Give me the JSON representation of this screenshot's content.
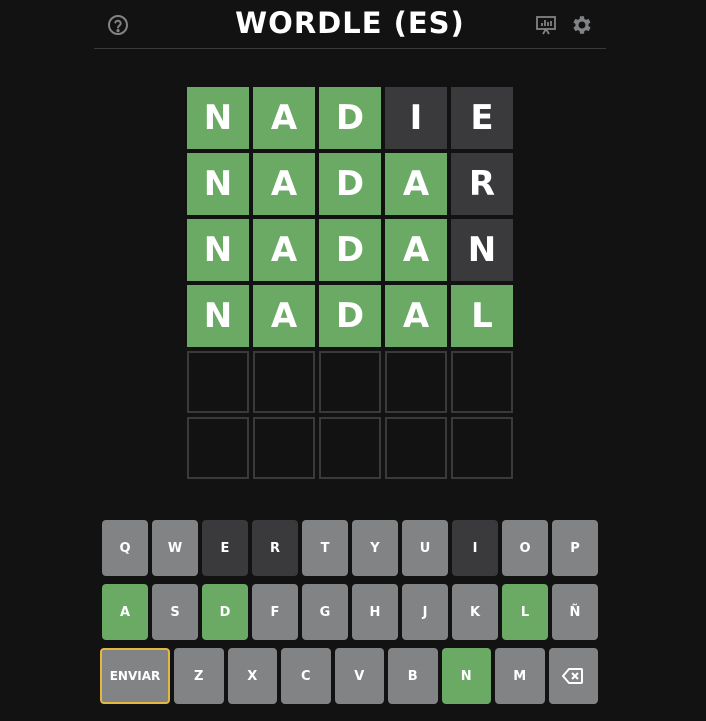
{
  "header": {
    "title": "WORDLE (ES)",
    "icons": [
      "help-icon",
      "stats-icon",
      "settings-icon"
    ]
  },
  "colors": {
    "correct": "#6aaa64",
    "absent": "#3a3a3c",
    "unused": "#818384",
    "background": "#121213",
    "enter_border": "#e4b73f"
  },
  "board": {
    "rows": [
      [
        {
          "l": "N",
          "s": "correct"
        },
        {
          "l": "A",
          "s": "correct"
        },
        {
          "l": "D",
          "s": "correct"
        },
        {
          "l": "I",
          "s": "absent"
        },
        {
          "l": "E",
          "s": "absent"
        }
      ],
      [
        {
          "l": "N",
          "s": "correct"
        },
        {
          "l": "A",
          "s": "correct"
        },
        {
          "l": "D",
          "s": "correct"
        },
        {
          "l": "A",
          "s": "correct"
        },
        {
          "l": "R",
          "s": "absent"
        }
      ],
      [
        {
          "l": "N",
          "s": "correct"
        },
        {
          "l": "A",
          "s": "correct"
        },
        {
          "l": "D",
          "s": "correct"
        },
        {
          "l": "A",
          "s": "correct"
        },
        {
          "l": "N",
          "s": "absent"
        }
      ],
      [
        {
          "l": "N",
          "s": "correct"
        },
        {
          "l": "A",
          "s": "correct"
        },
        {
          "l": "D",
          "s": "correct"
        },
        {
          "l": "A",
          "s": "correct"
        },
        {
          "l": "L",
          "s": "correct"
        }
      ],
      [
        {
          "l": "",
          "s": "empty"
        },
        {
          "l": "",
          "s": "empty"
        },
        {
          "l": "",
          "s": "empty"
        },
        {
          "l": "",
          "s": "empty"
        },
        {
          "l": "",
          "s": "empty"
        }
      ],
      [
        {
          "l": "",
          "s": "empty"
        },
        {
          "l": "",
          "s": "empty"
        },
        {
          "l": "",
          "s": "empty"
        },
        {
          "l": "",
          "s": "empty"
        },
        {
          "l": "",
          "s": "empty"
        }
      ]
    ]
  },
  "keyboard": {
    "rows": [
      [
        {
          "k": "Q",
          "s": "unused"
        },
        {
          "k": "W",
          "s": "unused"
        },
        {
          "k": "E",
          "s": "absent"
        },
        {
          "k": "R",
          "s": "absent"
        },
        {
          "k": "T",
          "s": "unused"
        },
        {
          "k": "Y",
          "s": "unused"
        },
        {
          "k": "U",
          "s": "unused"
        },
        {
          "k": "I",
          "s": "absent"
        },
        {
          "k": "O",
          "s": "unused"
        },
        {
          "k": "P",
          "s": "unused"
        }
      ],
      [
        {
          "k": "A",
          "s": "correct"
        },
        {
          "k": "S",
          "s": "unused"
        },
        {
          "k": "D",
          "s": "correct"
        },
        {
          "k": "F",
          "s": "unused"
        },
        {
          "k": "G",
          "s": "unused"
        },
        {
          "k": "H",
          "s": "unused"
        },
        {
          "k": "J",
          "s": "unused"
        },
        {
          "k": "K",
          "s": "unused"
        },
        {
          "k": "L",
          "s": "correct"
        },
        {
          "k": "Ñ",
          "s": "unused"
        }
      ],
      [
        {
          "k": "ENVIAR",
          "s": "enter"
        },
        {
          "k": "Z",
          "s": "unused"
        },
        {
          "k": "X",
          "s": "unused"
        },
        {
          "k": "C",
          "s": "unused"
        },
        {
          "k": "V",
          "s": "unused"
        },
        {
          "k": "B",
          "s": "unused"
        },
        {
          "k": "N",
          "s": "correct"
        },
        {
          "k": "M",
          "s": "unused"
        },
        {
          "k": "",
          "s": "backspace",
          "icon": "backspace-icon"
        }
      ]
    ]
  }
}
